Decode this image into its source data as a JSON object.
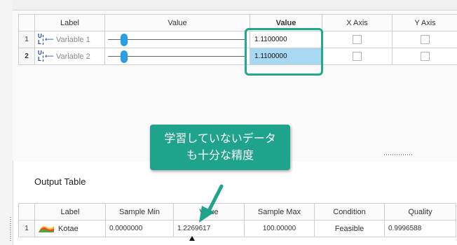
{
  "input_table": {
    "columns": [
      "Label",
      "Value",
      "Value",
      "X Axis",
      "Y Axis"
    ],
    "rows": [
      {
        "num": "1",
        "label": "Variable 1",
        "value": "1.1100000"
      },
      {
        "num": "2",
        "label": "Variable 2",
        "value": "1.1100000"
      }
    ]
  },
  "callout": {
    "line1": "学習していないデータ",
    "line2": "も十分な精度"
  },
  "output": {
    "title": "Output Table",
    "columns": [
      "Label",
      "Sample Min",
      "Value",
      "Sample Max",
      "Condition",
      "Quality"
    ],
    "rows": [
      {
        "num": "1",
        "label": "Kotae",
        "sample_min": "0.0000000",
        "value": "1.2269617",
        "sample_max": "100.00000",
        "condition": "Feasible",
        "quality": "0.9996588"
      }
    ]
  },
  "colors": {
    "accent": "#1fa38c",
    "slider": "#2a9ee0",
    "selected_cell": "#a9d8f2"
  }
}
